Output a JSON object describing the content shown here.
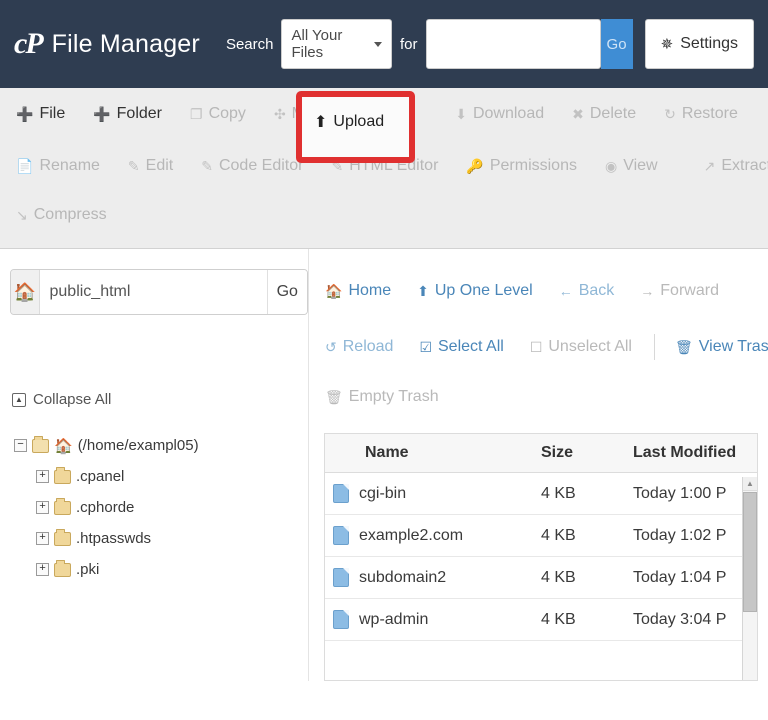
{
  "header": {
    "logo_text": "cP",
    "title": "File Manager",
    "search_label": "Search",
    "search_scope_value": "All Your Files",
    "for_label": "for",
    "search_value": "",
    "search_placeholder": "",
    "go_label": "Go",
    "settings_label": "Settings",
    "bg_color": "#2f3d51",
    "go_color": "#3f8dd4"
  },
  "toolbar": {
    "highlight_color": "#e03030",
    "row1": [
      {
        "label": "File",
        "icon": "plus-icon",
        "disabled": false
      },
      {
        "label": "Folder",
        "icon": "plus-icon",
        "disabled": false
      },
      {
        "label": "Copy",
        "icon": "copy-icon",
        "disabled": true
      },
      {
        "label": "Move",
        "icon": "move-icon",
        "disabled": true
      },
      {
        "label": "Upload",
        "icon": "upload-icon",
        "disabled": false
      },
      {
        "label": "Download",
        "icon": "download-icon",
        "disabled": true
      },
      {
        "label": "Delete",
        "icon": "delete-icon",
        "disabled": true
      },
      {
        "label": "Restore",
        "icon": "restore-icon",
        "disabled": true
      }
    ],
    "row2": [
      {
        "label": "Rename",
        "icon": "rename-icon",
        "disabled": true
      },
      {
        "label": "Edit",
        "icon": "edit-icon",
        "disabled": true
      },
      {
        "label": "Code Editor",
        "icon": "code-editor-icon",
        "disabled": true
      },
      {
        "label": "HTML Editor",
        "icon": "html-editor-icon",
        "disabled": true
      },
      {
        "label": "Permissions",
        "icon": "permissions-icon",
        "disabled": true
      },
      {
        "label": "View",
        "icon": "view-icon",
        "disabled": true
      }
    ],
    "row2_tail": [
      {
        "label": "Extract",
        "icon": "extract-icon",
        "disabled": true
      }
    ],
    "row3": [
      {
        "label": "Compress",
        "icon": "compress-icon",
        "disabled": true
      }
    ],
    "highlighted_item": "Upload"
  },
  "path_bar": {
    "home_icon": "home-icon",
    "value": "public_html",
    "placeholder": "",
    "go_label": "Go"
  },
  "nav": {
    "row1": [
      {
        "label": "Home",
        "icon": "home-icon",
        "state": "active"
      },
      {
        "label": "Up One Level",
        "icon": "up-arrow-icon",
        "state": "active"
      },
      {
        "label": "Back",
        "icon": "back-arrow-icon",
        "state": "normal"
      },
      {
        "label": "Forward",
        "icon": "forward-arrow-icon",
        "state": "muted"
      }
    ],
    "row2": [
      {
        "label": "Reload",
        "icon": "reload-icon",
        "state": "normal"
      },
      {
        "label": "Select All",
        "icon": "checkbox-checked-icon",
        "state": "active"
      },
      {
        "label": "Unselect All",
        "icon": "checkbox-empty-icon",
        "state": "muted"
      }
    ],
    "row2_tail": [
      {
        "label": "View Trash",
        "icon": "trash-icon",
        "state": "active"
      }
    ],
    "row3": [
      {
        "label": "Empty Trash",
        "icon": "trash-icon",
        "state": "muted"
      }
    ]
  },
  "tree": {
    "collapse_all_label": "Collapse All",
    "root": {
      "label": "(/home/exampl05)",
      "expander": "−",
      "icon": "folder-open-icon"
    },
    "children": [
      {
        "label": ".cpanel",
        "expander": "+",
        "icon": "folder-icon"
      },
      {
        "label": ".cphorde",
        "expander": "+",
        "icon": "folder-icon"
      },
      {
        "label": ".htpasswds",
        "expander": "+",
        "icon": "folder-icon"
      },
      {
        "label": ".pki",
        "expander": "+",
        "icon": "folder-icon"
      }
    ]
  },
  "file_table": {
    "columns": [
      "Name",
      "Size",
      "Last Modified"
    ],
    "rows": [
      {
        "name": "cgi-bin",
        "size": "4 KB",
        "modified": "Today 1:00 P",
        "icon": "folder-file-icon"
      },
      {
        "name": "example2.com",
        "size": "4 KB",
        "modified": "Today 1:02 P",
        "icon": "folder-file-icon"
      },
      {
        "name": "subdomain2",
        "size": "4 KB",
        "modified": "Today 1:04 P",
        "icon": "folder-file-icon"
      },
      {
        "name": "wp-admin",
        "size": "4 KB",
        "modified": "Today 3:04 P",
        "icon": "folder-file-icon"
      }
    ]
  }
}
